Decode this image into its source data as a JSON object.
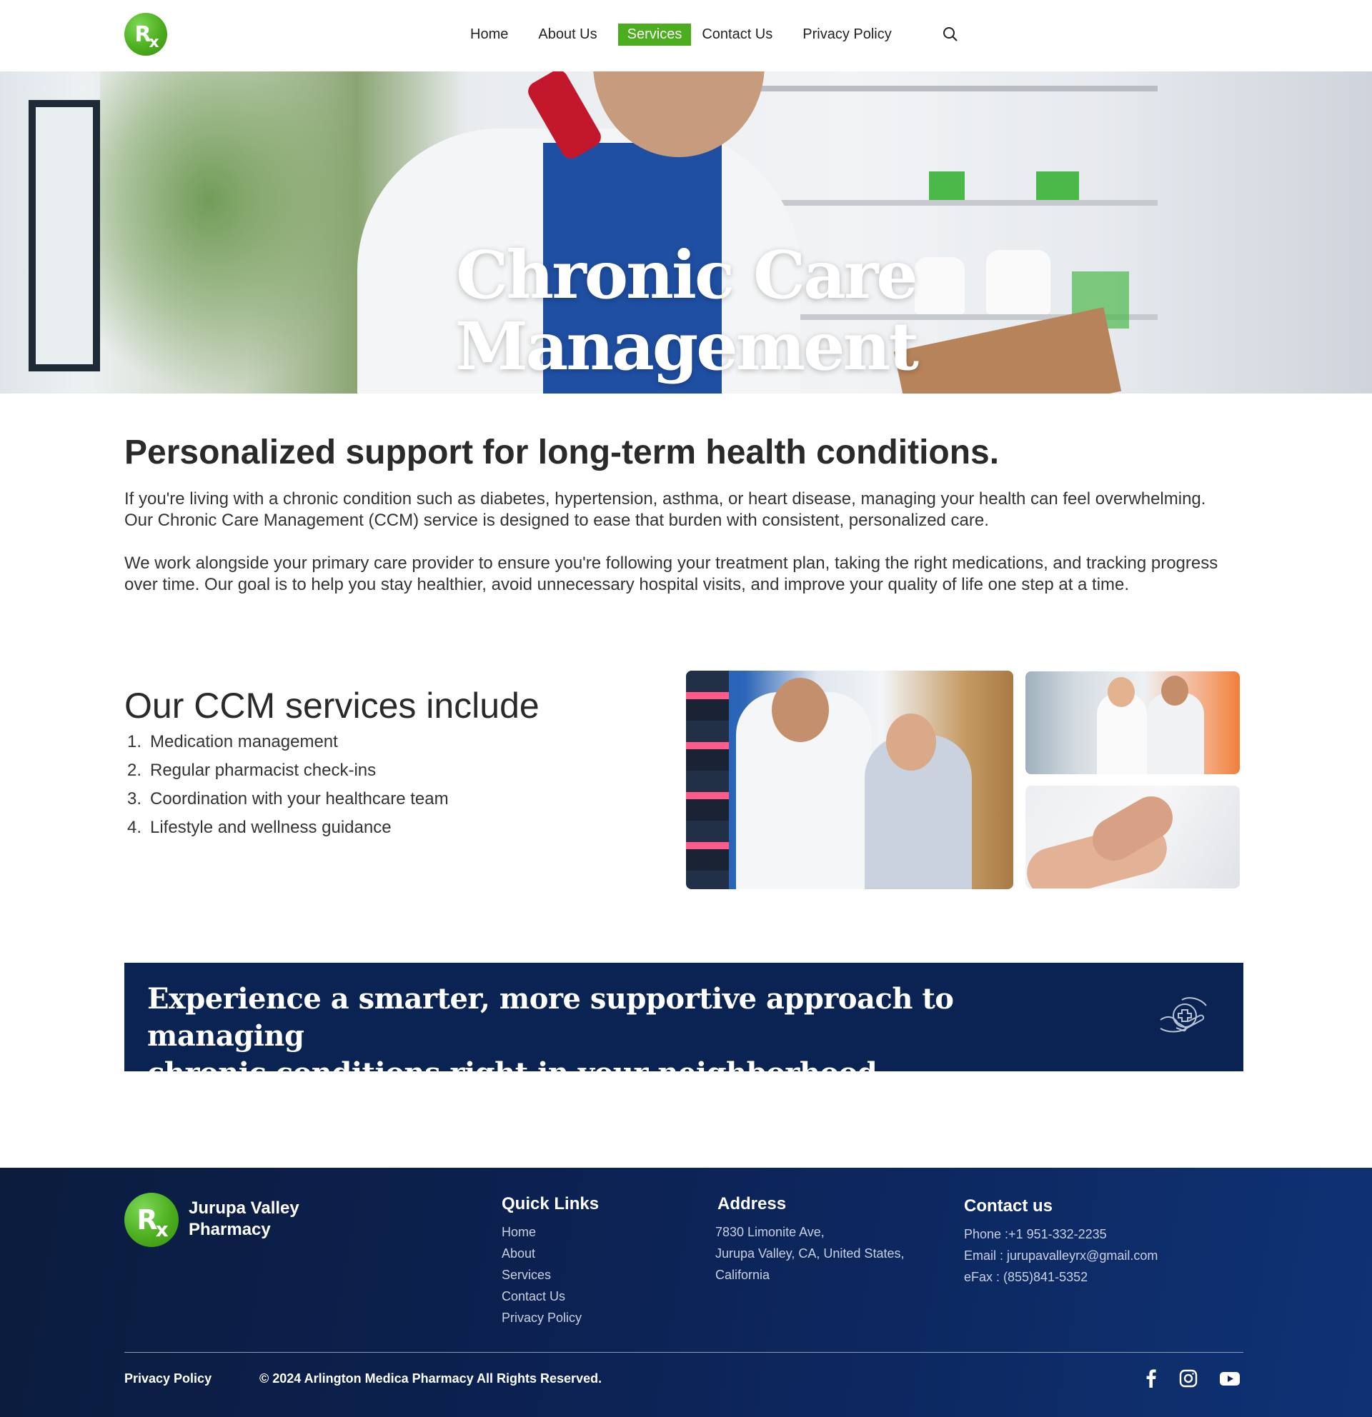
{
  "nav": {
    "items": [
      {
        "label": "Home",
        "active": false
      },
      {
        "label": "About Us",
        "active": false
      },
      {
        "label": "Services",
        "active": true
      },
      {
        "label": "Contact Us",
        "active": false
      },
      {
        "label": "Privacy Policy",
        "active": false
      }
    ],
    "search_icon": "search-icon"
  },
  "logo": {
    "text": "Rx"
  },
  "hero": {
    "title_line1": "Chronic Care",
    "title_line2": "Management"
  },
  "intro": {
    "heading": "Personalized support for long-term health conditions.",
    "paragraph1": "If you're living with a chronic condition such as diabetes, hypertension, asthma, or heart disease, managing your health can feel overwhelming. Our Chronic Care Management (CCM) service is designed to ease that burden with consistent, personalized care.",
    "paragraph2": "We work alongside your primary care provider to ensure you're following your treatment plan, taking the right medications, and tracking progress over time. Our goal is to help you stay healthier, avoid unnecessary hospital visits, and improve your quality of life one step at a time."
  },
  "services": {
    "heading": "Our CCM services include",
    "items": [
      {
        "num": "1.",
        "label": "Medication management"
      },
      {
        "num": "2.",
        "label": "Regular pharmacist check-ins"
      },
      {
        "num": "3.",
        "label": "Coordination with your healthcare team"
      },
      {
        "num": "4.",
        "label": "Lifestyle and wellness guidance"
      }
    ]
  },
  "cta": {
    "line1": "Experience a smarter, more supportive approach to managing",
    "line2": "chronic conditions right in your neighborhood pharmacy.",
    "icon": "medical-hands-icon"
  },
  "footer": {
    "brand_line1": "Jurupa Valley",
    "brand_line2": "Pharmacy",
    "quick_links_title": "Quick Links",
    "quick_links": [
      "Home",
      "About",
      "Services",
      "Contact Us",
      "Privacy Policy"
    ],
    "address_title": "Address",
    "address_lines": [
      "7830 Limonite Ave,",
      "Jurupa Valley, CA, United States,",
      "California"
    ],
    "contact_title": "Contact us",
    "phone": "Phone :+1 951-332-2235",
    "email": "Email : jurupavalleyrx@gmail.com",
    "efax": "eFax : (855)841-5352",
    "privacy": "Privacy Policy",
    "copyright": "© 2024 Arlington Medica Pharmacy All Rights Reserved.",
    "social_icons": [
      "facebook-icon",
      "instagram-icon",
      "youtube-icon"
    ]
  },
  "colors": {
    "accent_green": "#4cae1e",
    "navy": "#0a2353",
    "footer_navy": "#0c2254"
  }
}
